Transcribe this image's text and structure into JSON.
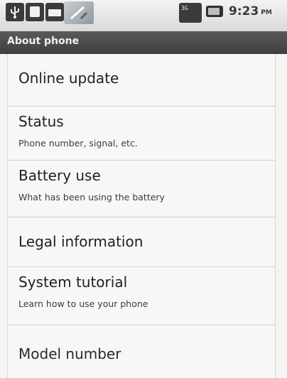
{
  "status_bar": {
    "time": "9:23",
    "ampm": "PM",
    "signal_label": "3G",
    "icons": [
      "usb-icon",
      "sd-card-icon",
      "tty-icon",
      "tools-icon",
      "signal-icon",
      "battery-icon"
    ]
  },
  "header": {
    "title": "About phone"
  },
  "menu": {
    "items": [
      {
        "title": "Online update"
      },
      {
        "title": "Status",
        "subtitle": "Phone number, signal, etc."
      },
      {
        "title": "Battery use",
        "subtitle": "What has been using the battery"
      },
      {
        "title": "Legal information"
      },
      {
        "title": "System tutorial",
        "subtitle": "Learn how to use your phone"
      },
      {
        "title": "Model number"
      }
    ]
  },
  "colors": {
    "title_bar": "#4a4a4a",
    "background": "#f4f4f2",
    "text": "#1f1f1f"
  }
}
